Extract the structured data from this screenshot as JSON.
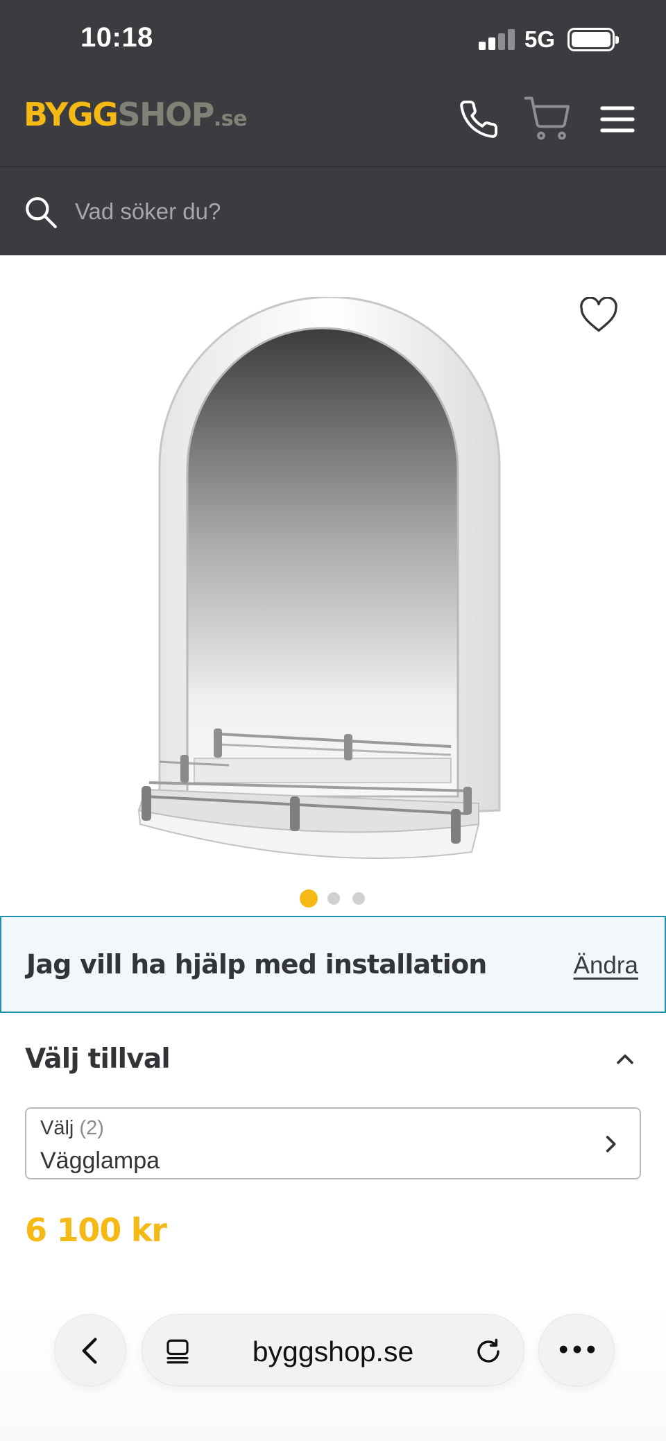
{
  "status_bar": {
    "time": "10:18",
    "network": "5G"
  },
  "header": {
    "logo": {
      "part1": "BYGG",
      "part2": "SHOP",
      "part3": ".se"
    },
    "icons": [
      "phone-icon",
      "cart-icon",
      "menu-icon"
    ]
  },
  "search": {
    "placeholder": "Vad söker du?"
  },
  "gallery": {
    "slide_count": 3,
    "active_slide": 1
  },
  "help_banner": {
    "text": "Jag vill ha hjälp med installation",
    "link": "Ändra"
  },
  "options": {
    "title": "Välj tillval",
    "select": {
      "label": "Välj",
      "count": "(2)",
      "value": "Vägglampa"
    }
  },
  "product": {
    "price": "6 100 kr"
  },
  "browser": {
    "url": "byggshop.se"
  },
  "colors": {
    "header_bg": "#3b3c40",
    "brand_yellow": "#f5b916",
    "banner_bg": "#f1f7fb",
    "banner_border": "#1f8fb0"
  }
}
